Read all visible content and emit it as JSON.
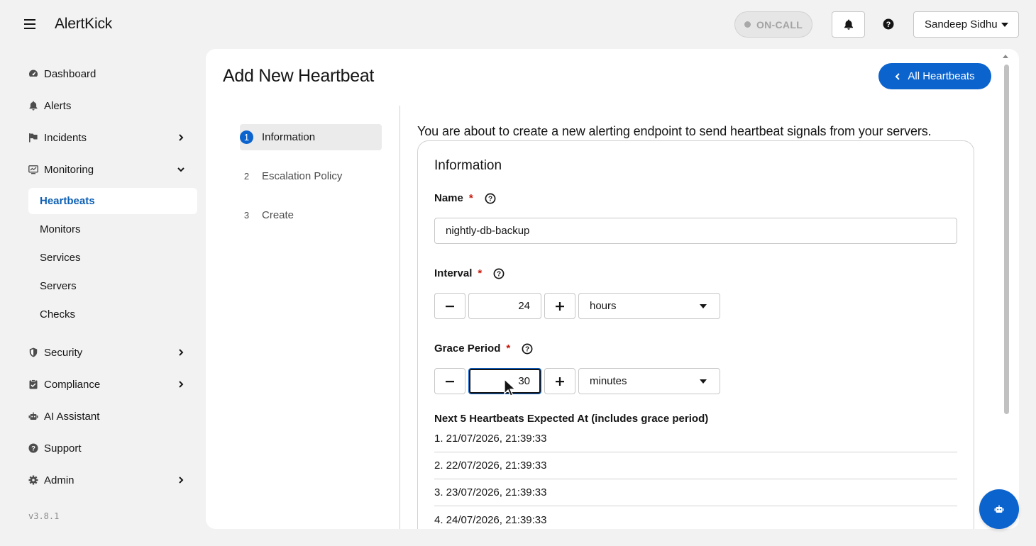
{
  "app": {
    "name": "AlertKick",
    "version": "v3.8.1"
  },
  "topbar": {
    "oncall_label": "ON-CALL",
    "user_name": "Sandeep Sidhu"
  },
  "sidebar": {
    "items": [
      {
        "label": "Dashboard",
        "icon": "dashboard-icon"
      },
      {
        "label": "Alerts",
        "icon": "bell-icon"
      },
      {
        "label": "Incidents",
        "icon": "flag-icon"
      },
      {
        "label": "Monitoring",
        "icon": "monitor-icon"
      },
      {
        "label": "Security",
        "icon": "shield-icon"
      },
      {
        "label": "Compliance",
        "icon": "clipboard-check-icon"
      },
      {
        "label": "AI Assistant",
        "icon": "robot-icon"
      },
      {
        "label": "Support",
        "icon": "question-circle-icon"
      },
      {
        "label": "Admin",
        "icon": "gear-icon"
      }
    ],
    "monitoring_sub": [
      "Heartbeats",
      "Monitors",
      "Services",
      "Servers",
      "Checks"
    ]
  },
  "page": {
    "title": "Add New Heartbeat",
    "back_label": "All Heartbeats",
    "steps": [
      {
        "num": "1",
        "label": "Information"
      },
      {
        "num": "2",
        "label": "Escalation Policy"
      },
      {
        "num": "3",
        "label": "Create"
      }
    ],
    "intro": "You are about to create a new alerting endpoint to send heartbeat signals from your servers."
  },
  "form": {
    "card_title": "Information",
    "name_label": "Name",
    "name_value": "nightly-db-backup",
    "interval_label": "Interval",
    "interval_value": "24",
    "interval_unit": "hours",
    "grace_label": "Grace Period",
    "grace_value": "30",
    "grace_unit": "minutes",
    "required_mark": "*"
  },
  "next": {
    "title": "Next 5 Heartbeats Expected At (includes grace period)",
    "items": [
      "1. 21/07/2026, 21:39:33",
      "2. 22/07/2026, 21:39:33",
      "3. 23/07/2026, 21:39:33",
      "4. 24/07/2026, 21:39:33"
    ]
  },
  "colors": {
    "primary": "#0b63ce",
    "active_text": "#0c5fb4",
    "required": "#c9190b"
  }
}
